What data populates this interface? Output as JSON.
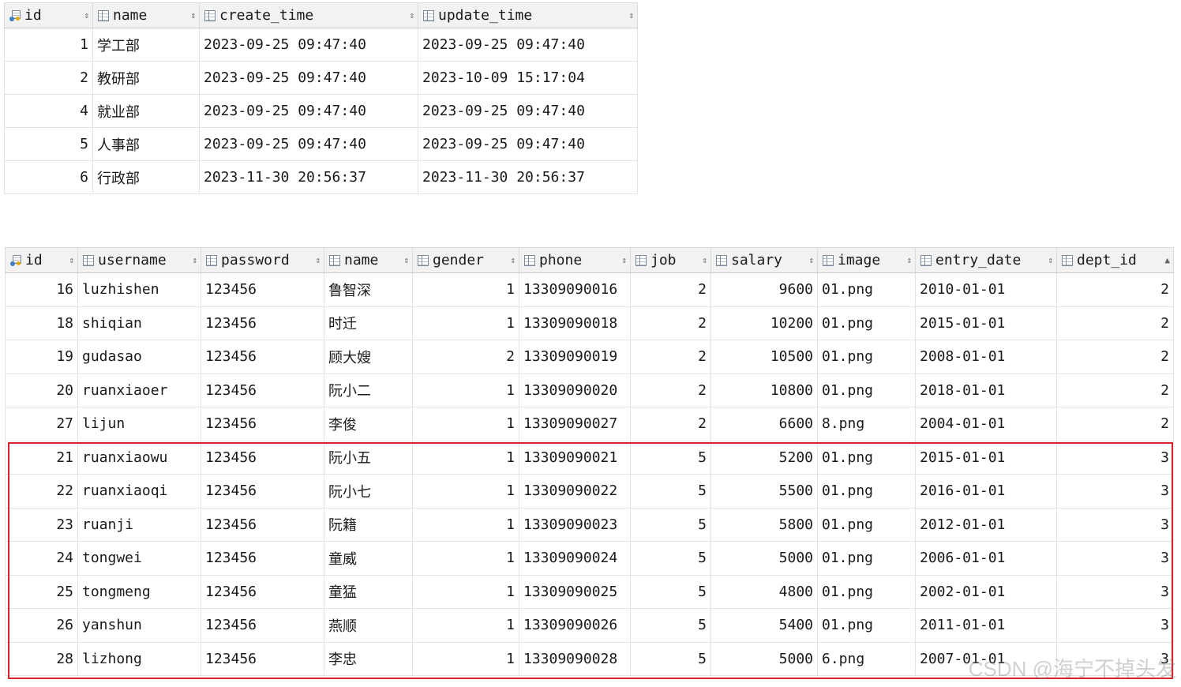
{
  "dept_table": {
    "columns": [
      {
        "label": "id",
        "type": "key",
        "sort": "⇕"
      },
      {
        "label": "name",
        "type": "col",
        "sort": "⇕"
      },
      {
        "label": "create_time",
        "type": "col",
        "sort": "⇕"
      },
      {
        "label": "update_time",
        "type": "col",
        "sort": "⇕"
      }
    ],
    "rows": [
      [
        "1",
        "学工部",
        "2023-09-25 09:47:40",
        "2023-09-25 09:47:40"
      ],
      [
        "2",
        "教研部",
        "2023-09-25 09:47:40",
        "2023-10-09 15:17:04"
      ],
      [
        "4",
        "就业部",
        "2023-09-25 09:47:40",
        "2023-09-25 09:47:40"
      ],
      [
        "5",
        "人事部",
        "2023-09-25 09:47:40",
        "2023-09-25 09:47:40"
      ],
      [
        "6",
        "行政部",
        "2023-11-30 20:56:37",
        "2023-11-30 20:56:37"
      ]
    ]
  },
  "emp_table": {
    "columns": [
      {
        "label": "id",
        "type": "key",
        "sort": "⇕"
      },
      {
        "label": "username",
        "type": "col",
        "sort": "⇕"
      },
      {
        "label": "password",
        "type": "col",
        "sort": "⇕"
      },
      {
        "label": "name",
        "type": "col",
        "sort": "⇕"
      },
      {
        "label": "gender",
        "type": "col",
        "sort": "⇕"
      },
      {
        "label": "phone",
        "type": "col",
        "sort": "⇕"
      },
      {
        "label": "job",
        "type": "col",
        "sort": "⇕"
      },
      {
        "label": "salary",
        "type": "col",
        "sort": "⇕"
      },
      {
        "label": "image",
        "type": "col",
        "sort": "⇕"
      },
      {
        "label": "entry_date",
        "type": "col",
        "sort": "⇕"
      },
      {
        "label": "dept_id",
        "type": "col",
        "sort": "▲"
      }
    ],
    "rows": [
      [
        "16",
        "luzhishen",
        "123456",
        "鲁智深",
        "1",
        "13309090016",
        "2",
        "9600",
        "01.png",
        "2010-01-01",
        "2"
      ],
      [
        "18",
        "shiqian",
        "123456",
        "时迁",
        "1",
        "13309090018",
        "2",
        "10200",
        "01.png",
        "2015-01-01",
        "2"
      ],
      [
        "19",
        "gudasao",
        "123456",
        "顾大嫂",
        "2",
        "13309090019",
        "2",
        "10500",
        "01.png",
        "2008-01-01",
        "2"
      ],
      [
        "20",
        "ruanxiaoer",
        "123456",
        "阮小二",
        "1",
        "13309090020",
        "2",
        "10800",
        "01.png",
        "2018-01-01",
        "2"
      ],
      [
        "27",
        "lijun",
        "123456",
        "李俊",
        "1",
        "13309090027",
        "2",
        "6600",
        "8.png",
        "2004-01-01",
        "2"
      ],
      [
        "21",
        "ruanxiaowu",
        "123456",
        "阮小五",
        "1",
        "13309090021",
        "5",
        "5200",
        "01.png",
        "2015-01-01",
        "3"
      ],
      [
        "22",
        "ruanxiaoqi",
        "123456",
        "阮小七",
        "1",
        "13309090022",
        "5",
        "5500",
        "01.png",
        "2016-01-01",
        "3"
      ],
      [
        "23",
        "ruanji",
        "123456",
        "阮籍",
        "1",
        "13309090023",
        "5",
        "5800",
        "01.png",
        "2012-01-01",
        "3"
      ],
      [
        "24",
        "tongwei",
        "123456",
        "童威",
        "1",
        "13309090024",
        "5",
        "5000",
        "01.png",
        "2006-01-01",
        "3"
      ],
      [
        "25",
        "tongmeng",
        "123456",
        "童猛",
        "1",
        "13309090025",
        "5",
        "4800",
        "01.png",
        "2002-01-01",
        "3"
      ],
      [
        "26",
        "yanshun",
        "123456",
        "燕顺",
        "1",
        "13309090026",
        "5",
        "5400",
        "01.png",
        "2011-01-01",
        "3"
      ],
      [
        "28",
        "lizhong",
        "123456",
        "李忠",
        "1",
        "13309090028",
        "5",
        "5000",
        "6.png",
        "2007-01-01",
        "3"
      ]
    ]
  },
  "watermark": "CSDN @海宁不掉头发",
  "colors": {
    "highlight": "#d9232e",
    "header_bg": "#f2f2f2",
    "key_blue": "#3f7fbf",
    "key_gold": "#e0a800"
  }
}
